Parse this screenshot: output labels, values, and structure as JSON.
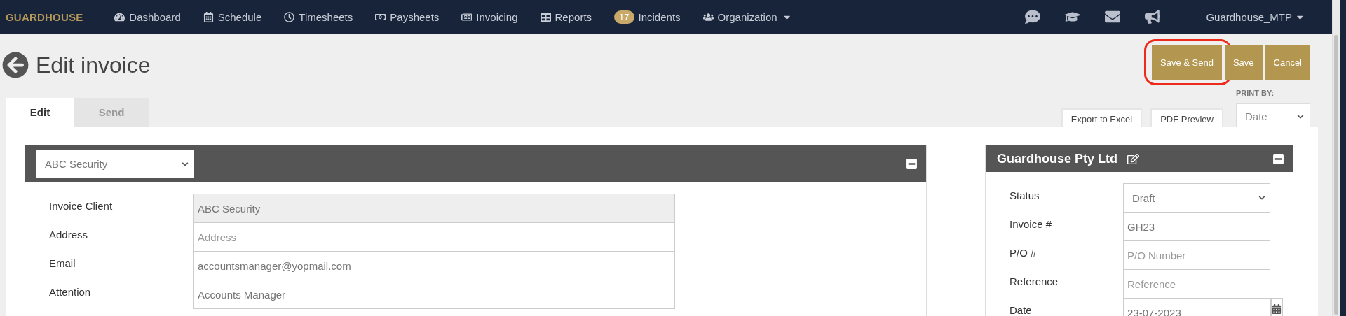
{
  "nav": {
    "logo": "GUARDHOUSE",
    "items": [
      {
        "label": "Dashboard",
        "dropdown": false
      },
      {
        "label": "Schedule",
        "dropdown": false
      },
      {
        "label": "Timesheets",
        "dropdown": false
      },
      {
        "label": "Paysheets",
        "dropdown": false
      },
      {
        "label": "Invoicing",
        "dropdown": false
      },
      {
        "label": "Reports",
        "dropdown": false
      },
      {
        "label": "Incidents",
        "badge": "17",
        "dropdown": false
      },
      {
        "label": "Organization",
        "dropdown": true
      }
    ],
    "user": {
      "label": "Guardhouse_MTP",
      "dropdown": true
    }
  },
  "page": {
    "title": "Edit invoice",
    "tabs": [
      {
        "label": "Edit",
        "selected": true
      },
      {
        "label": "Send",
        "selected": false
      }
    ],
    "actions": [
      {
        "label": "Save & Send",
        "highlighted": true
      },
      {
        "label": "Save",
        "highlighted": false
      },
      {
        "label": "Cancel",
        "highlighted": false
      }
    ],
    "tools": [
      "Export to Excel",
      "PDF Preview"
    ],
    "print_by": {
      "label": "PRINT BY:",
      "value": "Date"
    }
  },
  "client_panel": {
    "client": "ABC Security",
    "fields": [
      {
        "label": "Invoice Client",
        "value": "ABC Security",
        "disabled": true
      },
      {
        "label": "Address",
        "placeholder": "Address",
        "disabled": false
      },
      {
        "label": "Email",
        "value": "accountsmanager@yopmail.com",
        "disabled": false
      },
      {
        "label": "Attention",
        "value": "Accounts Manager",
        "disabled": false
      }
    ]
  },
  "company_panel": {
    "title": "Guardhouse Pty Ltd",
    "fields": [
      {
        "label": "Status",
        "kind": "select",
        "value": "Draft"
      },
      {
        "label": "Invoice #",
        "kind": "text",
        "value": "GH23"
      },
      {
        "label": "P/O #",
        "kind": "text",
        "placeholder": "P/O Number"
      },
      {
        "label": "Reference",
        "kind": "text",
        "placeholder": "Reference"
      },
      {
        "label": "Date",
        "kind": "date",
        "value": "23-07-2023"
      }
    ]
  }
}
